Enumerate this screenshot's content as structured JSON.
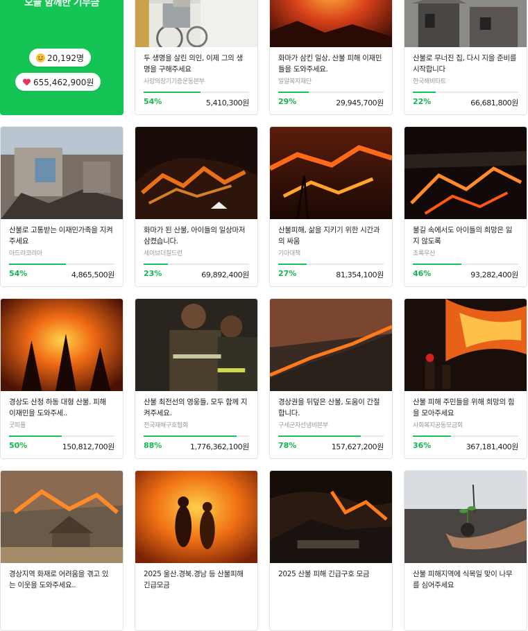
{
  "summary": {
    "title": "오늘 함께한 기부금",
    "participants": "20,192명",
    "total_amount": "655,462,900원",
    "participants_icon": "smile-emoji-icon",
    "amount_icon": "heart-icon"
  },
  "accent_color": "#14c455",
  "cards": [
    {
      "title": "두 생명을 살린 의인, 이제 그의 생명을 구해주세요",
      "org": "사랑의장기기증운동본부",
      "percent": "54%",
      "progress": 0.54,
      "amount": "5,410,300원"
    },
    {
      "title": "화마가 삼킨 일상, 산불 피해 이재민들을 도와주세요.",
      "org": "밀알복지재단",
      "percent": "29%",
      "progress": 0.29,
      "amount": "29,945,700원"
    },
    {
      "title": "산불로 무너진 집, 다시 지을 준비를 시작합니다",
      "org": "한국해비타트",
      "percent": "22%",
      "progress": 0.22,
      "amount": "66,681,800원"
    },
    {
      "title": "산불로 고통받는 이재민가족을 지켜주세요",
      "org": "아드라코리아",
      "percent": "54%",
      "progress": 0.54,
      "amount": "4,865,500원"
    },
    {
      "title": "화마가 된 산불, 아이들의 일상마저 삼켰습니다.",
      "org": "세이브더칠드런",
      "percent": "23%",
      "progress": 0.23,
      "amount": "69,892,400원"
    },
    {
      "title": "산불피해, 삶을 지키기 위한 시간과의 싸움",
      "org": "기아대책",
      "percent": "27%",
      "progress": 0.27,
      "amount": "81,354,100원"
    },
    {
      "title": "불길 속에서도 아이들의 희망은 잃지 않도록",
      "org": "초록우산",
      "percent": "46%",
      "progress": 0.46,
      "amount": "93,282,400원"
    },
    {
      "title": "경상도 산청 하동 대형 산불. 피해 이재민을 도와주세..",
      "org": "굿피플",
      "percent": "50%",
      "progress": 0.5,
      "amount": "150,812,700원"
    },
    {
      "title": "산불 최전선의 영웅들, 모두 함께 지켜주세요.",
      "org": "전국재해구호협회",
      "percent": "88%",
      "progress": 0.88,
      "amount": "1,776,362,100원"
    },
    {
      "title": "경상권을 뒤덮은 산불, 도움이 간절합니다.",
      "org": "구세군자선냄비본부",
      "percent": "78%",
      "progress": 0.78,
      "amount": "157,627,200원"
    },
    {
      "title": "산불 피해 주민들을 위해 희망의 힘을 모아주세요",
      "org": "사회복지공동모금회",
      "percent": "36%",
      "progress": 0.36,
      "amount": "367,181,400원"
    },
    {
      "title": "경상지역 화재로 어려움을 겪고 있는 이웃을 도와주세요..",
      "org": "",
      "percent": "",
      "progress": 0,
      "amount": ""
    },
    {
      "title": "2025 울산.경북.경남 등 산불피해 긴급모금",
      "org": "",
      "percent": "",
      "progress": 0,
      "amount": ""
    },
    {
      "title": "2025 산불 피해 긴급구호 모금",
      "org": "",
      "percent": "",
      "progress": 0,
      "amount": ""
    },
    {
      "title": "산불 피해지역에 식목일 맞이 나무를 심어주세요",
      "org": "",
      "percent": "",
      "progress": 0,
      "amount": ""
    }
  ]
}
